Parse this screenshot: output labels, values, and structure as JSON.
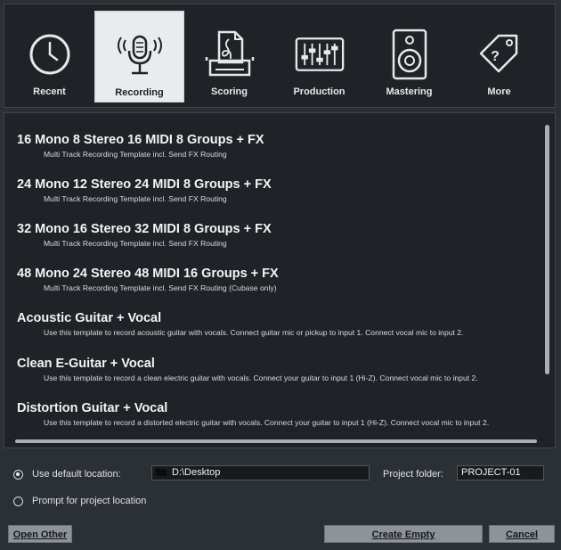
{
  "categories": [
    {
      "label": "Recent",
      "icon": "clock-icon",
      "active": false
    },
    {
      "label": "Recording",
      "icon": "microphone-icon",
      "active": true
    },
    {
      "label": "Scoring",
      "icon": "score-printer-icon",
      "active": false
    },
    {
      "label": "Production",
      "icon": "mixer-faders-icon",
      "active": false
    },
    {
      "label": "Mastering",
      "icon": "speaker-icon",
      "active": false
    },
    {
      "label": "More",
      "icon": "tag-question-icon",
      "active": false
    }
  ],
  "templates": [
    {
      "title": "16 Mono 8 Stereo 16 MIDI 8 Groups + FX",
      "desc": "Multi Track Recording Template incl. Send FX Routing"
    },
    {
      "title": "24 Mono 12 Stereo 24 MIDI 8 Groups + FX",
      "desc": "Multi Track Recording Template incl. Send FX Routing"
    },
    {
      "title": "32 Mono 16 Stereo 32 MIDI 8 Groups + FX",
      "desc": "Multi Track Recording Template incl. Send FX Routing"
    },
    {
      "title": "48 Mono 24 Stereo 48 MIDI 16 Groups + FX",
      "desc": "Multi Track Recording Template incl. Send FX Routing (Cubase only)"
    },
    {
      "title": "Acoustic Guitar + Vocal",
      "desc": "Use this template to record acoustic guitar with vocals. Connect guitar mic or pickup to input  1. Connect vocal mic to input 2."
    },
    {
      "title": "Clean E-Guitar + Vocal",
      "desc": "Use this template to record a clean electric guitar with vocals. Connect your guitar to input  1 (Hi-Z). Connect vocal mic to input 2."
    },
    {
      "title": "Distortion Guitar + Vocal",
      "desc": "Use this template to record a distorted electric guitar with vocals. Connect your guitar to input  1 (Hi-Z). Connect vocal mic to input 2."
    }
  ],
  "location": {
    "default_label": "Use default location:",
    "default_checked": true,
    "path": "D:\\Desktop",
    "project_folder_label": "Project folder:",
    "project_folder_value": "PROJECT-01",
    "prompt_label": "Prompt for project location",
    "prompt_checked": false
  },
  "buttons": {
    "open_other": "Open Other",
    "create_empty": "Create Empty",
    "cancel": "Cancel"
  }
}
